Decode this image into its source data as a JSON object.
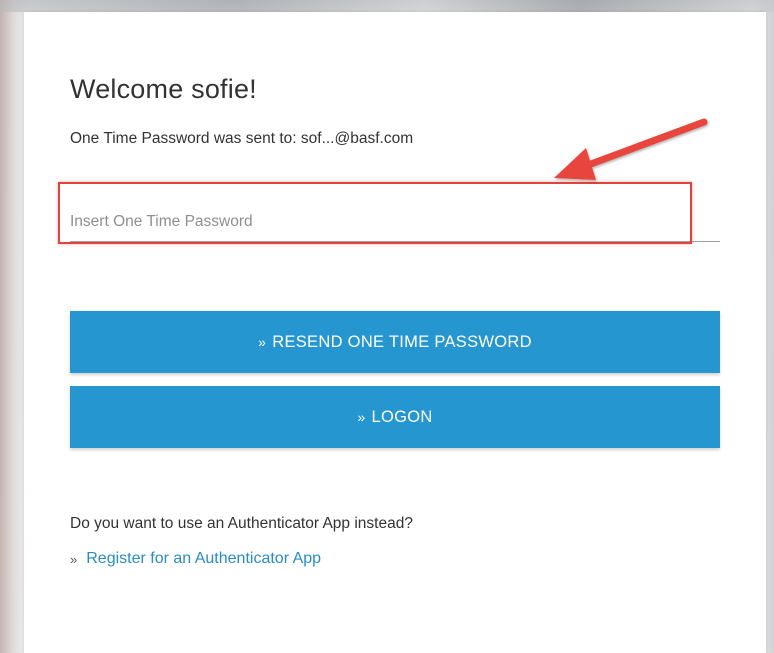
{
  "login": {
    "title": "Welcome sofie!",
    "sent_label": "One Time Password was sent to:",
    "sent_email": "sof...@basf.com",
    "otp_placeholder": "Insert One Time Password",
    "otp_value": "",
    "resend_chevron": "»",
    "resend_label": "RESEND ONE TIME PASSWORD",
    "logon_chevron": "»",
    "logon_label": "LOGON",
    "authenticator_question": "Do you want to use an Authenticator App instead?",
    "register_chevron": "»",
    "register_link": "Register for an Authenticator App"
  },
  "annotation": {
    "highlight_color": "#e0443c",
    "arrow_icon": "red-arrow-icon"
  },
  "colors": {
    "button": "#2596cf",
    "link": "#2a8cc4",
    "text": "#333333"
  }
}
